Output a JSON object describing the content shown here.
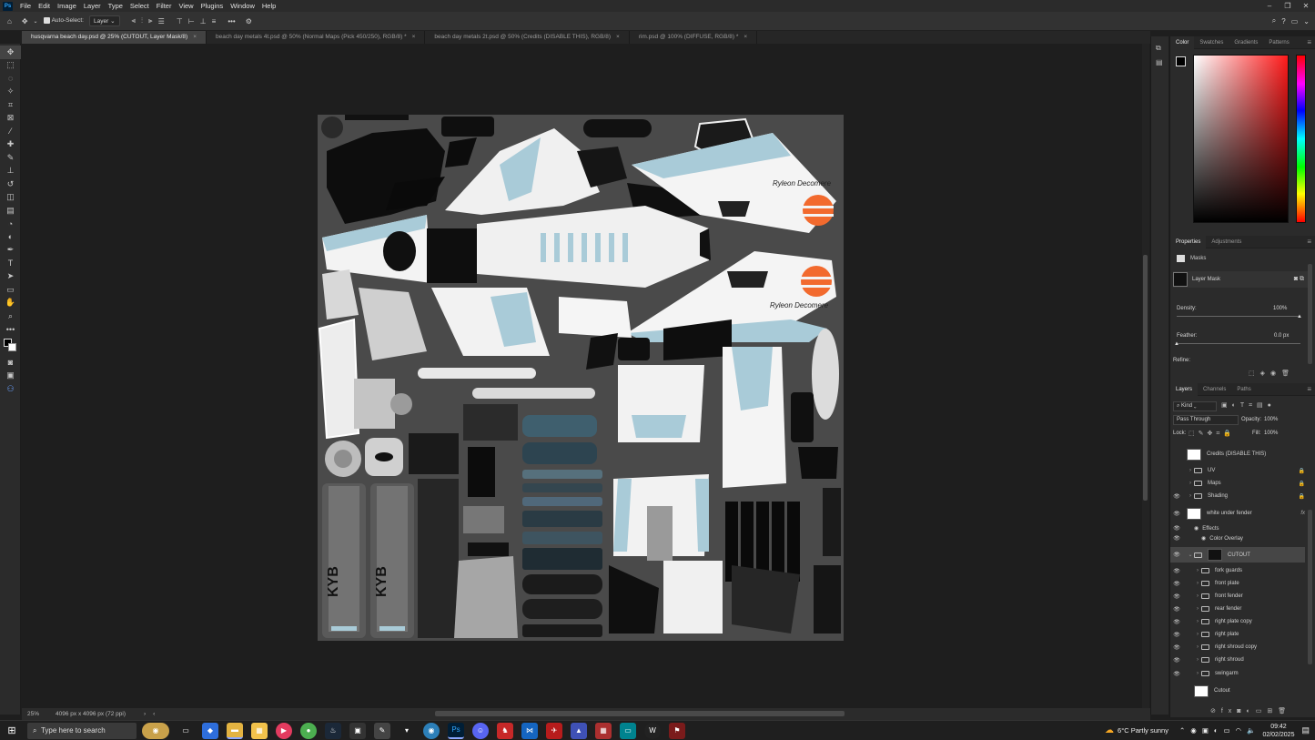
{
  "app": {
    "logo": "Ps"
  },
  "menu": [
    "File",
    "Edit",
    "Image",
    "Layer",
    "Type",
    "Select",
    "Filter",
    "View",
    "Plugins",
    "Window",
    "Help"
  ],
  "options": {
    "auto_select_label": "Auto-Select:",
    "auto_select_value": "Layer"
  },
  "tabs": [
    {
      "label": "husqvarna beach day.psd @ 25% (CUTOUT, Layer Mask/8)",
      "active": true
    },
    {
      "label": "beach day metals 4t.psd @ 50% (Normal Maps (Pick 450/250), RGB/8) *",
      "active": false
    },
    {
      "label": "beach day metals 2t.psd @ 50% (Credits (DISABLE THIS), RGB/8)",
      "active": false
    },
    {
      "label": "rim.psd @ 100% (DIFFUSE, RGB/8) *",
      "active": false
    }
  ],
  "status": {
    "zoom": "25%",
    "doc_size": "4096 px x 4096 px (72 ppi)"
  },
  "color_panel": {
    "tabs": [
      "Color",
      "Swatches",
      "Gradients",
      "Patterns"
    ]
  },
  "properties_panel": {
    "tabs": [
      "Properties",
      "Adjustments"
    ],
    "section": "Masks",
    "mask_label": "Layer Mask",
    "density_label": "Density:",
    "density_value": "100%",
    "feather_label": "Feather:",
    "feather_value": "0.0 px",
    "refine_label": "Refine:"
  },
  "layers_panel": {
    "tabs": [
      "Layers",
      "Channels",
      "Paths"
    ],
    "filter_label": "Kind",
    "blend_mode": "Pass Through",
    "opacity_label": "Opacity:",
    "opacity_value": "100%",
    "lock_label": "Lock:",
    "fill_label": "Fill:",
    "fill_value": "100%",
    "layers": [
      {
        "name": "Credits (DISABLE THIS)",
        "type": "thumb",
        "visible": false,
        "indent": 0
      },
      {
        "name": "UV",
        "type": "group",
        "visible": false,
        "indent": 0,
        "locked": true
      },
      {
        "name": "Maps",
        "type": "group",
        "visible": false,
        "indent": 0,
        "locked": true
      },
      {
        "name": "Shading",
        "type": "group",
        "visible": true,
        "indent": 0,
        "locked": true
      },
      {
        "name": "white under fender",
        "type": "thumb",
        "visible": true,
        "indent": 0,
        "fx": "fx"
      },
      {
        "name": "Effects",
        "type": "effects",
        "visible": true,
        "indent": 1
      },
      {
        "name": "Color Overlay",
        "type": "effects",
        "visible": true,
        "indent": 2
      },
      {
        "name": "CUTOUT",
        "type": "maskgroup",
        "visible": true,
        "indent": 0,
        "selected": true
      },
      {
        "name": "fork guards",
        "type": "group",
        "visible": true,
        "indent": 1
      },
      {
        "name": "front plate",
        "type": "group",
        "visible": true,
        "indent": 1
      },
      {
        "name": "front fender",
        "type": "group",
        "visible": true,
        "indent": 1
      },
      {
        "name": "rear fender",
        "type": "group",
        "visible": true,
        "indent": 1
      },
      {
        "name": "right plate copy",
        "type": "group",
        "visible": true,
        "indent": 1
      },
      {
        "name": "right plate",
        "type": "group",
        "visible": true,
        "indent": 1
      },
      {
        "name": "right shroud copy",
        "type": "group",
        "visible": true,
        "indent": 1
      },
      {
        "name": "right shroud",
        "type": "group",
        "visible": true,
        "indent": 1
      },
      {
        "name": "swingarm",
        "type": "group",
        "visible": true,
        "indent": 1
      },
      {
        "name": "Cutout",
        "type": "thumb",
        "visible": false,
        "indent": 1
      }
    ]
  },
  "canvas_text": {
    "brand_script_1": "Ryleon Decomere",
    "brand_script_2": "Ryleon Decomere",
    "kyb_1": "KYB",
    "kyb_2": "KYB"
  },
  "taskbar": {
    "search_placeholder": "Type here to search",
    "weather": "6°C  Partly sunny",
    "time": "09:42",
    "date": "02/02/2025"
  }
}
